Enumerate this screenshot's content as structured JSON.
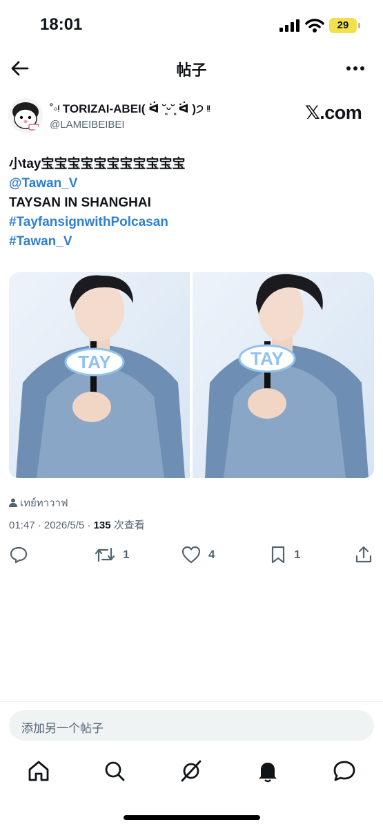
{
  "status": {
    "time": "18:01",
    "battery": "29"
  },
  "header": {
    "title": "帖子"
  },
  "author": {
    "display_name": "˚◦ᵎ TORIZAI-ABEI( ᐛ ˘͈ᵕ˘͈ ᐛ )੭ ᵎᵎ",
    "handle": "@LAMEIBEIBEI",
    "source_logo": "𝕏.com"
  },
  "post": {
    "lines": [
      "小tay宝宝宝宝宝宝宝宝宝宝宝",
      "@Tawan_V",
      "TAYSAN IN SHANGHAI",
      "#TayfansignwithPolcasan",
      "#Tawan_V"
    ],
    "location": "เทย์ทาวาฟ",
    "time": "01:47 · 2026/5/5 · ",
    "views_count": "135",
    "views_label": " 次查看"
  },
  "media": [
    {
      "sign_text": "TAY"
    },
    {
      "sign_text": "TAY"
    }
  ],
  "actions": {
    "retweets": "1",
    "likes": "4",
    "bookmarks": "1"
  },
  "composer": {
    "placeholder": "添加另一个帖子"
  },
  "icons": {
    "back": "back-arrow-icon",
    "more": "more-icon",
    "reply": "reply-icon",
    "retweet": "retweet-icon",
    "like": "heart-icon",
    "bookmark": "bookmark-icon",
    "share": "share-icon",
    "home": "home-icon",
    "search": "search-icon",
    "grok": "grok-icon",
    "notifications": "bell-icon",
    "messages": "messages-icon"
  },
  "colors": {
    "link": "#2f7fd1",
    "text": "#0f1419",
    "secondary": "#536471",
    "battery": "#f3e14b"
  }
}
